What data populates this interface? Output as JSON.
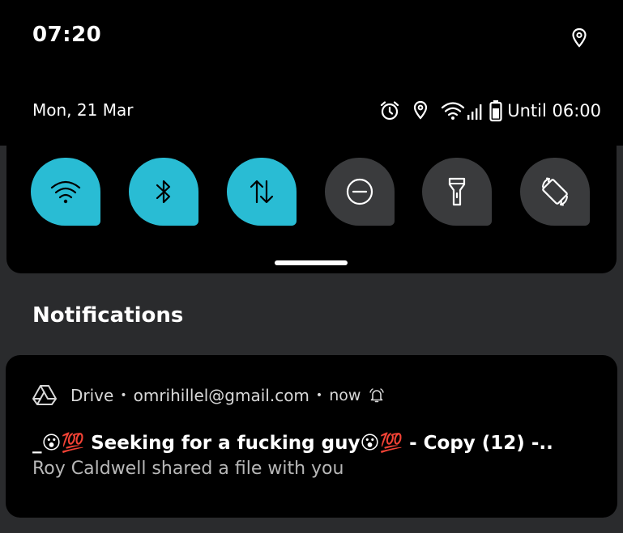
{
  "status_bar": {
    "time": "07:20",
    "date": "Mon, 21 Mar",
    "until": "Until 06:00",
    "icons": [
      "location-icon",
      "alarm-icon",
      "location-icon",
      "wifi-icon",
      "signal-icon",
      "battery-icon"
    ]
  },
  "quick_settings": {
    "tiles": [
      {
        "name": "wifi",
        "state": "on",
        "icon": "wifi-icon"
      },
      {
        "name": "bluetooth",
        "state": "on",
        "icon": "bluetooth-icon"
      },
      {
        "name": "mobile-data",
        "state": "on",
        "icon": "data-arrows-icon"
      },
      {
        "name": "do-not-disturb",
        "state": "off",
        "icon": "dnd-icon"
      },
      {
        "name": "flashlight",
        "state": "off",
        "icon": "flashlight-icon"
      },
      {
        "name": "auto-rotate",
        "state": "off",
        "icon": "rotate-icon"
      }
    ],
    "accent": "#29bcd4",
    "inactive": "#3a3b3d"
  },
  "notifications": {
    "heading": "Notifications",
    "items": [
      {
        "app": "Drive",
        "account": "omrihillel@gmail.com",
        "time": "now",
        "title": "_😮💯 Seeking for a fucking guy😮💯 - Copy (12) -..",
        "text": "Roy Caldwell shared a file with you"
      }
    ]
  }
}
